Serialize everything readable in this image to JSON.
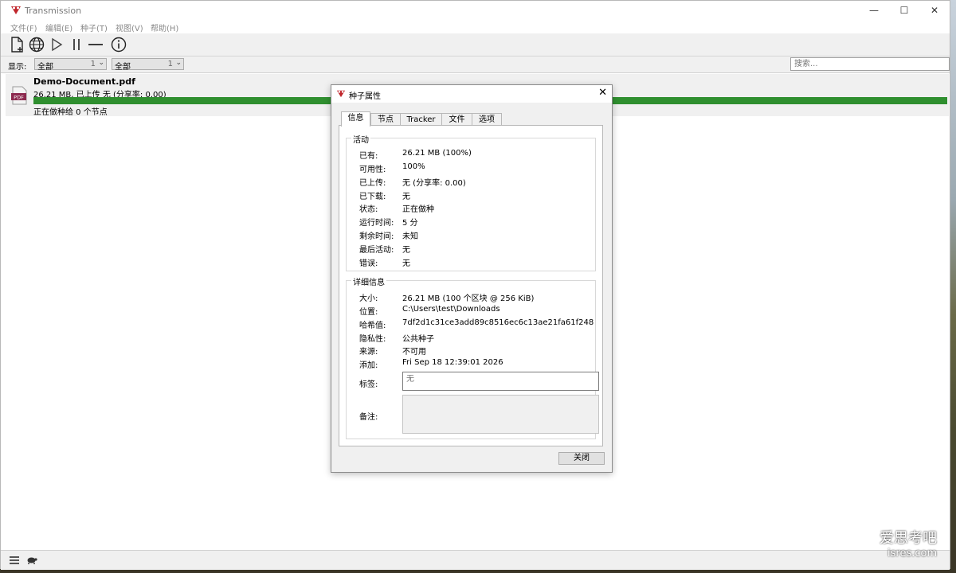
{
  "window": {
    "title": "Transmission",
    "controls": {
      "minimize": "—",
      "maximize": "☐",
      "close": "✕"
    }
  },
  "menu": [
    "文件(F)",
    "编辑(E)",
    "种子(T)",
    "视图(V)",
    "帮助(H)"
  ],
  "toolbar": {
    "icons": [
      "new-file-icon",
      "globe-icon",
      "play-icon",
      "pause-icon",
      "remove-icon",
      "info-icon"
    ]
  },
  "filter": {
    "label": "显示:",
    "select1": {
      "value": "全部",
      "count": "1"
    },
    "select2": {
      "value": "全部",
      "count": "1"
    },
    "search_placeholder": "搜索..."
  },
  "torrent": {
    "name": "Demo-Document.pdf",
    "sub": "26.21 MB, 已上传 无 (分享率: 0.00)",
    "progress": 100,
    "status": "正在做种给 0 个节点",
    "icon_label": "PDF"
  },
  "dialog": {
    "title": "种子属性",
    "close_glyph": "✕",
    "tabs": [
      "信息",
      "节点",
      "Tracker",
      "文件",
      "选项"
    ],
    "activity": {
      "title": "活动",
      "rows": [
        {
          "label": "已有:",
          "value": "26.21 MB (100%)"
        },
        {
          "label": "可用性:",
          "value": "100%"
        },
        {
          "label": "已上传:",
          "value": "无 (分享率: 0.00)"
        },
        {
          "label": "已下载:",
          "value": "无"
        },
        {
          "label": "状态:",
          "value": "正在做种"
        },
        {
          "label": "运行时间:",
          "value": "5 分"
        },
        {
          "label": "剩余时间:",
          "value": "未知"
        },
        {
          "label": "最后活动:",
          "value": "无"
        },
        {
          "label": "错误:",
          "value": "无"
        }
      ]
    },
    "details": {
      "title": "详细信息",
      "rows": [
        {
          "label": "大小:",
          "value": "26.21 MB (100 个区块 @ 256 KiB)"
        },
        {
          "label": "位置:",
          "value": "C:\\Users\\test\\Downloads"
        },
        {
          "label": "哈希值:",
          "value": "7df2d1c31ce3add89c8516ec6c13ae21fa61f248"
        },
        {
          "label": "隐私性:",
          "value": "公共种子"
        },
        {
          "label": "来源:",
          "value": "不可用"
        },
        {
          "label": "添加:",
          "value": "Fri Sep 18 12:39:01 2026"
        }
      ],
      "labels_label": "标签:",
      "labels_placeholder": "无",
      "comment_label": "备注:"
    },
    "close_button": "关闭"
  },
  "watermark": {
    "line1": "爱思考吧",
    "line2": "isres.com"
  },
  "colors": {
    "progress": "#2f8f2f",
    "accent_red": "#c0262c"
  }
}
